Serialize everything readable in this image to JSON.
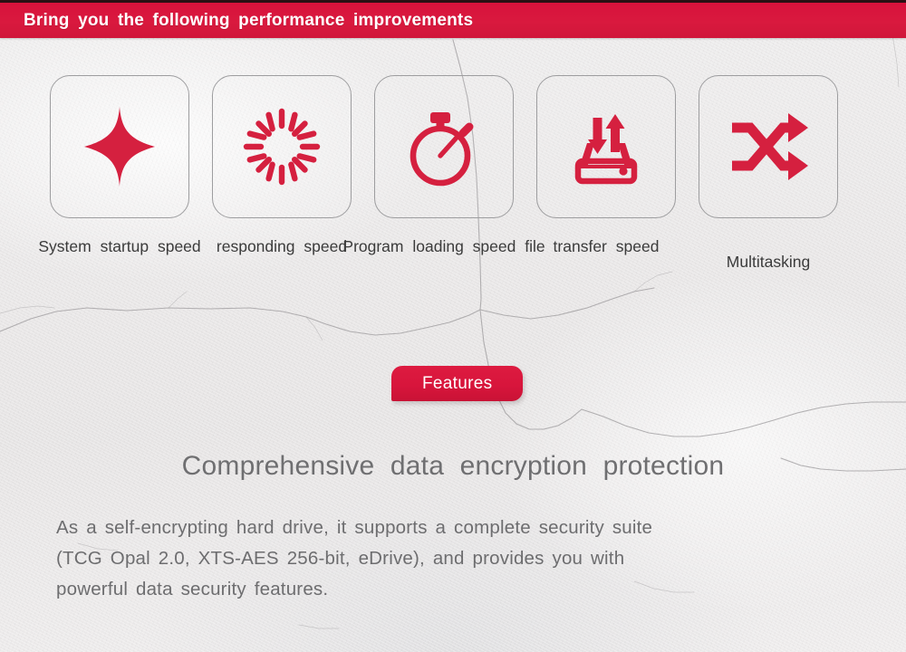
{
  "header": {
    "title": "Bring you the following performance improvements",
    "bar_color": "#d8143c",
    "text_color": "#ffffff"
  },
  "theme": {
    "accent_red": "#d8143c",
    "icon_red": "#d5203f",
    "card_border": "#9d9d9f",
    "label_text": "#3b3b3b",
    "heading_text": "#6f6f71",
    "body_text": "#6d6d6f",
    "background": "#ebe9e9"
  },
  "features_row": {
    "items": [
      {
        "icon": "sparkle-star-icon",
        "label_line1": "System",
        "label_line2": "startup  speed",
        "single_line": false
      },
      {
        "icon": "loading-spinner-icon",
        "label_line1": "responding",
        "label_line2": "speed",
        "single_line": false
      },
      {
        "icon": "stopwatch-icon",
        "label_line1": "Program  loading",
        "label_line2": "speed  file",
        "single_line": false
      },
      {
        "icon": "drive-transfer-icon",
        "label_line1": "transfer",
        "label_line2": "speed",
        "single_line": false
      },
      {
        "icon": "shuffle-arrows-icon",
        "label_line1": "Multitasking",
        "label_line2": "",
        "single_line": true
      }
    ]
  },
  "features_section": {
    "ribbon_label": "Features",
    "heading": "Comprehensive  data  encryption  protection",
    "paragraph_lines": [
      "As a self-encrypting hard drive, it supports a complete security suite",
      "(TCG Opal 2.0, XTS-AES 256-bit, eDrive), and provides you with",
      "powerful data security features."
    ]
  }
}
